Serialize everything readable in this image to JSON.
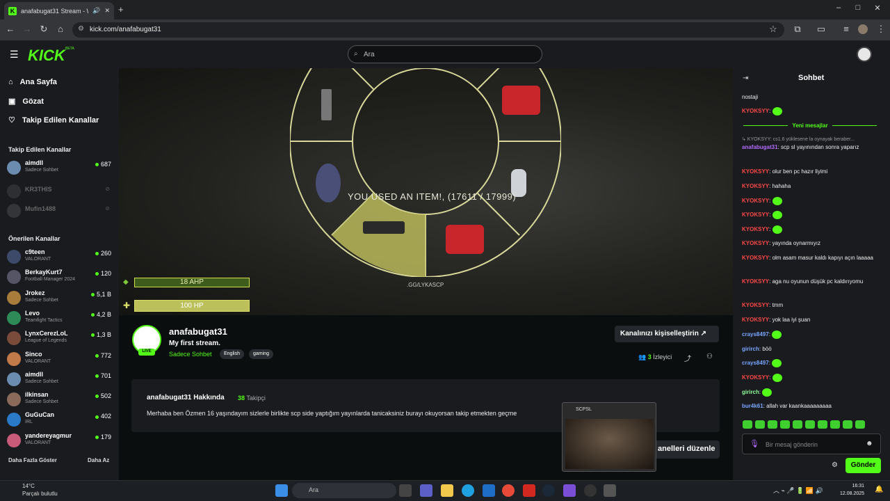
{
  "browser": {
    "tab_title": "anafabugat31 Stream - Wa",
    "url": "kick.com/anafabugat31",
    "new_tab": "+",
    "minimize": "–",
    "maximize": "□",
    "close": "✕"
  },
  "header": {
    "logo": "KICK",
    "beta": "BETA",
    "search_placeholder": "Ara"
  },
  "sidebar": {
    "nav": [
      {
        "label": "Ana Sayfa",
        "icon": "home-icon"
      },
      {
        "label": "Gözat",
        "icon": "browse-icon"
      },
      {
        "label": "Takip Edilen Kanallar",
        "icon": "heart-icon"
      }
    ],
    "followed_header": "Takip Edilen Kanallar",
    "followed": [
      {
        "name": "aimdll",
        "sub": "Sadece Sohbet",
        "count": "687",
        "online": true
      },
      {
        "name": "KR3THIS",
        "sub": "",
        "count": "",
        "online": false
      },
      {
        "name": "Mufin1488",
        "sub": "",
        "count": "",
        "online": false
      }
    ],
    "recommended_header": "Önerilen Kanallar",
    "recommended": [
      {
        "name": "c9teen",
        "sub": "VALORANT",
        "count": "260"
      },
      {
        "name": "BerkayKurt7",
        "sub": "Football Manager 2024",
        "count": "120"
      },
      {
        "name": "Jrokez",
        "sub": "Sadece Sohbet",
        "count": "5,1 B"
      },
      {
        "name": "Levo",
        "sub": "Teamfight Tactics",
        "count": "4,2 B"
      },
      {
        "name": "LynxCerezLoL",
        "sub": "League of Legends",
        "count": "1,3 B"
      },
      {
        "name": "Sinco",
        "sub": "VALORANT",
        "count": "772"
      },
      {
        "name": "aimdll",
        "sub": "Sadece Sohbet",
        "count": "701"
      },
      {
        "name": "ilkinsan",
        "sub": "Sadece Sohbet",
        "count": "502"
      },
      {
        "name": "GuGuCan",
        "sub": "IRL",
        "count": "402"
      },
      {
        "name": "yandereyagmur",
        "sub": "VALORANT",
        "count": "179"
      }
    ],
    "show_more": "Daha Fazla Göster",
    "show_less": "Daha Az"
  },
  "video": {
    "hud_text": "YOU USED AN ITEM!, (17611 / 17999)",
    "ahp": "18 AHP",
    "hp": "100 HP",
    "server": ".GG/LYKASCP"
  },
  "channel": {
    "name": "anafabugat31",
    "title": "My first stream.",
    "category": "Sadece Sohbet",
    "tags": [
      "English",
      "gaming"
    ],
    "live": "LIVE",
    "customize": "Kanalınızı kişiselleştirin",
    "viewers_count": "3",
    "viewers_label": "İzleyici",
    "about_header": "anafabugat31 Hakkında",
    "followers_count": "38",
    "followers_label": "Takipçi",
    "about_text": "Merhaba ben Özmen 16 yaşındayım sizlerle birlikte scp side yaptığım yayınlarda tanicaksiniz burayı okuyorsan takip etmekten geçme",
    "edit_panels": "anelleri düzenle",
    "thumb_title": "SCPSL"
  },
  "chat": {
    "header": "Sohbet",
    "new_messages": "Yeni mesajlar",
    "messages_top": [
      {
        "user": "",
        "text": "nostaji"
      },
      {
        "user": "KYOKSYY",
        "text": ""
      }
    ],
    "reply_ref": "↳ KYOKSYY: cs1.6 yüklesene la oynayak beraber...",
    "messages": [
      {
        "user": "anafabugat31",
        "cls": "p",
        "text": "scp sl yayınından sonra yaparız"
      },
      {
        "user": "KYOKSYY",
        "cls": "",
        "text": "olur ben pc hazır liyimi"
      },
      {
        "user": "KYOKSYY",
        "cls": "",
        "text": "hahaha"
      },
      {
        "user": "KYOKSYY",
        "cls": "",
        "text": ""
      },
      {
        "user": "KYOKSYY",
        "cls": "",
        "text": ""
      },
      {
        "user": "KYOKSYY",
        "cls": "",
        "text": ""
      },
      {
        "user": "KYOKSYY",
        "cls": "",
        "text": "yayında oynarmıyız"
      },
      {
        "user": "KYOKSYY",
        "cls": "",
        "text": "olm asam masur kaldı kapıyı açın laaaaa"
      },
      {
        "user": "KYOKSYY",
        "cls": "",
        "text": "aga nu oyunun düşük pc kaldırıyomu"
      },
      {
        "user": "KYOKSYY",
        "cls": "",
        "text": "tmm"
      },
      {
        "user": "KYOKSYY",
        "cls": "",
        "text": "yok laa iyi şuan"
      },
      {
        "user": "crays8497",
        "cls": "b",
        "text": ""
      },
      {
        "user": "girirch",
        "cls": "b",
        "text": "böö"
      },
      {
        "user": "crays8497",
        "cls": "b",
        "text": ""
      },
      {
        "user": "KYOKSYY",
        "cls": "",
        "text": ""
      },
      {
        "user": "girirch",
        "cls": "g",
        "text": ""
      },
      {
        "user": "bur4k61",
        "cls": "b",
        "text": "allah var kaankaaaaaaaaa"
      }
    ],
    "input_placeholder": "Bir mesaj gönderin",
    "send": "Gönder"
  },
  "taskbar": {
    "temp": "14°C",
    "weather": "Parçalı bulutlu",
    "search": "Ara",
    "time": "16:31",
    "date": "12.08.2025"
  }
}
